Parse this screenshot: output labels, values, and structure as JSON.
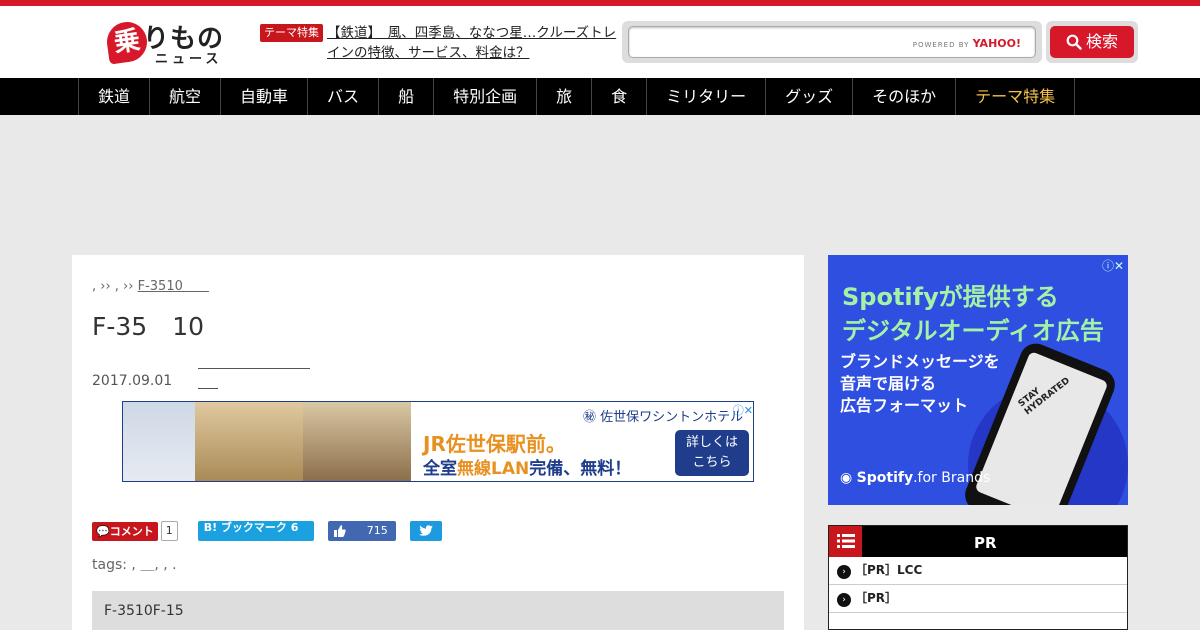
{
  "header": {
    "logo_mark": "乗",
    "logo_text1": "りもの",
    "logo_text2": "ニュース",
    "theme_badge": "テーマ特集",
    "theme_link": "【鉄道】　風、四季島、ななつ星…クルーズトレインの特徴、サービス、料金は？",
    "search_placeholder": "",
    "powered_by": "POWERED BY",
    "powered_brand": "YAHOO!",
    "search_button": "検索"
  },
  "nav": {
    "items": [
      "鉄道",
      "航空",
      "自動車",
      "バス",
      "船",
      "特別企画",
      "旅",
      "食",
      "ミリタリー",
      "グッズ",
      "そのほか",
      "テーマ特集"
    ]
  },
  "article": {
    "breadcrumb_sep": ", ›› , ››",
    "breadcrumb_link": "F-3510　　",
    "title": "F-35　10　　　　　　　　　　　　　　　　　　　　　　　　　　",
    "date": "2017.09.01",
    "tags_label": "tags: , ＿, , .",
    "summary": "F-3510F-15"
  },
  "ad_banner": {
    "brand": "㊙ 佐世保ワシントンホテル",
    "headline": "JR佐世保駅前。",
    "sub_prefix": "全室",
    "sub_highlight": "無線LAN",
    "sub_suffix": "完備、無料！",
    "cta": "詳しくは\nこちら",
    "close": "ⓘ✕"
  },
  "social": {
    "comment_label": "コメント",
    "comment_count": "1",
    "hatena_label": "B! ブックマーク 6",
    "like_count": "715"
  },
  "side_ad": {
    "line1": "Spotifyが提供する",
    "line2": "デジタルオーディオ広告",
    "line3a": "ブランドメッセージを",
    "line3b": "音声で届ける",
    "line3c": "広告フォーマット",
    "brand": "Spotify",
    "brand_suffix": ".for Brands",
    "phone_label": "STAY HYDRATED",
    "close": "ⓘ✕"
  },
  "pr": {
    "title": "　　　　　　　PR",
    "items": [
      {
        "prefix": "［PR］LCC",
        "text": "　　　　　　　　　　　　　　　　　　　　　　　　　　　　　　　　　　　　"
      },
      {
        "prefix": "［PR］",
        "text": "　　　　　　　　　　　　　　　　　　　　　　　　"
      }
    ]
  },
  "colors": {
    "brand_red": "#d7182a",
    "nav_bg": "#000000",
    "theme_accent": "#f5c14a",
    "spotify_bg": "#2e4fe0",
    "spotify_text": "#a4f2a6"
  }
}
